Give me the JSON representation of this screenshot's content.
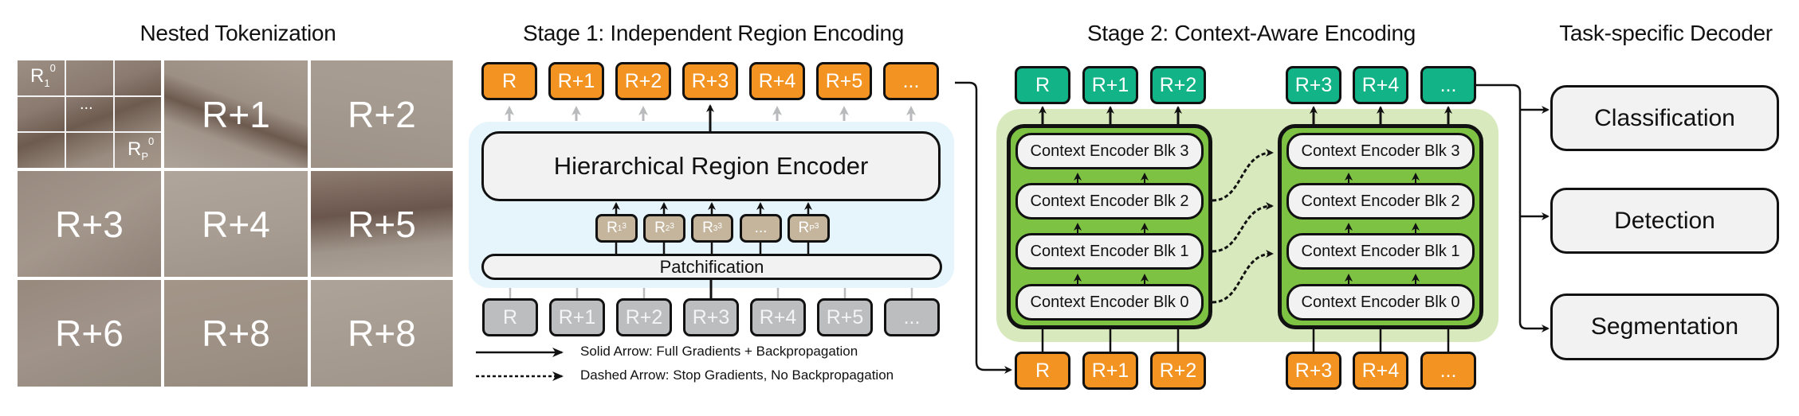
{
  "titles": {
    "nested": "Nested Tokenization",
    "stage1": "Stage 1: Independent Region Encoding",
    "stage2": "Stage 2: Context-Aware Encoding",
    "decoder": "Task-specific Decoder"
  },
  "grid": {
    "cells": [
      "",
      "R+1",
      "R+2",
      "R+3",
      "R+4",
      "R+5",
      "R+6",
      "R+8",
      "R+8"
    ],
    "sub_first": {
      "base": "R",
      "sup": "0",
      "sub": "1"
    },
    "sub_ellipsis": "...",
    "sub_last": {
      "base": "R",
      "sup": "0",
      "sub": "P"
    }
  },
  "stage1": {
    "output_tokens": [
      "R",
      "R+1",
      "R+2",
      "R+3",
      "R+4",
      "R+5",
      "..."
    ],
    "encoder_label": "Hierarchical Region Encoder",
    "patch_tokens": [
      {
        "base": "R",
        "sup": "3",
        "sub": "1"
      },
      {
        "base": "R",
        "sup": "3",
        "sub": "2"
      },
      {
        "base": "R",
        "sup": "3",
        "sub": "3"
      },
      {
        "base": "...",
        "sup": "",
        "sub": ""
      },
      {
        "base": "R",
        "sup": "3",
        "sub": "P"
      }
    ],
    "patchification_label": "Patchification",
    "input_tokens": [
      "R",
      "R+1",
      "R+2",
      "R+3",
      "R+4",
      "R+5",
      "..."
    ]
  },
  "legend": {
    "solid": "Solid Arrow: Full Gradients + Backpropagation",
    "dashed": "Dashed Arrow: Stop Gradients, No Backpropagation"
  },
  "stage2": {
    "groups": [
      {
        "outputs": [
          "R",
          "R+1",
          "R+2"
        ],
        "inputs": [
          "R",
          "R+1",
          "R+2"
        ]
      },
      {
        "outputs": [
          "R+3",
          "R+4",
          "..."
        ],
        "inputs": [
          "R+3",
          "R+4",
          "..."
        ]
      }
    ],
    "blocks": [
      "Context Encoder Blk 3",
      "Context Encoder Blk 2",
      "Context Encoder Blk 1",
      "Context Encoder Blk 0"
    ]
  },
  "decoder": {
    "tasks": [
      "Classification",
      "Detection",
      "Segmentation"
    ]
  },
  "colors": {
    "orange": "#f39422",
    "teal": "#12b386",
    "gray": "#bcbdbf",
    "tan": "#c4b59c",
    "light_blue": "#e6f4fc",
    "light_green": "#d9e9be",
    "green": "#7dc243"
  }
}
